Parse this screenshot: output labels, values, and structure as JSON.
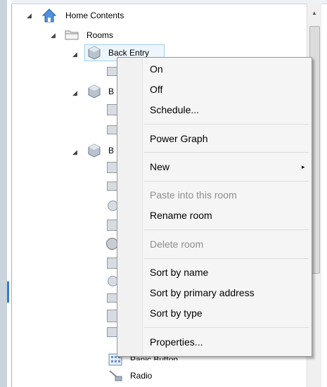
{
  "tree": {
    "root": {
      "label": "Home Contents"
    },
    "rooms": {
      "label": "Rooms"
    },
    "selected_room": {
      "label": "Back Entry"
    },
    "room_b": {
      "label": "B"
    },
    "room_c": {
      "label": "B"
    },
    "panic": {
      "label": "Panic Button"
    },
    "radio": {
      "label": "Radio"
    }
  },
  "context_menu": {
    "items": [
      {
        "label": "On",
        "enabled": true
      },
      {
        "label": "Off",
        "enabled": true
      },
      {
        "label": "Schedule...",
        "enabled": true
      },
      {
        "label": "Power Graph",
        "enabled": true
      },
      {
        "label": "New",
        "enabled": true,
        "submenu": true
      },
      {
        "label": "Paste into this room",
        "enabled": false
      },
      {
        "label": "Rename room",
        "enabled": true
      },
      {
        "label": "Delete room",
        "enabled": false
      },
      {
        "label": "Sort by name",
        "enabled": true
      },
      {
        "label": "Sort by primary address",
        "enabled": true
      },
      {
        "label": "Sort by type",
        "enabled": true
      },
      {
        "label": "Properties...",
        "enabled": true
      }
    ],
    "submenu_arrow": "▸"
  },
  "icons": {
    "expand": "◢",
    "home": "home-icon",
    "folder": "folder-icon",
    "room": "room-icon",
    "device": "device-icon"
  },
  "colors": {
    "selection_border": "#9fd0f5",
    "selection_fill": "#eef6fd",
    "menu_bg": "#f5f5f5",
    "disabled_text": "#8d8d8d"
  }
}
